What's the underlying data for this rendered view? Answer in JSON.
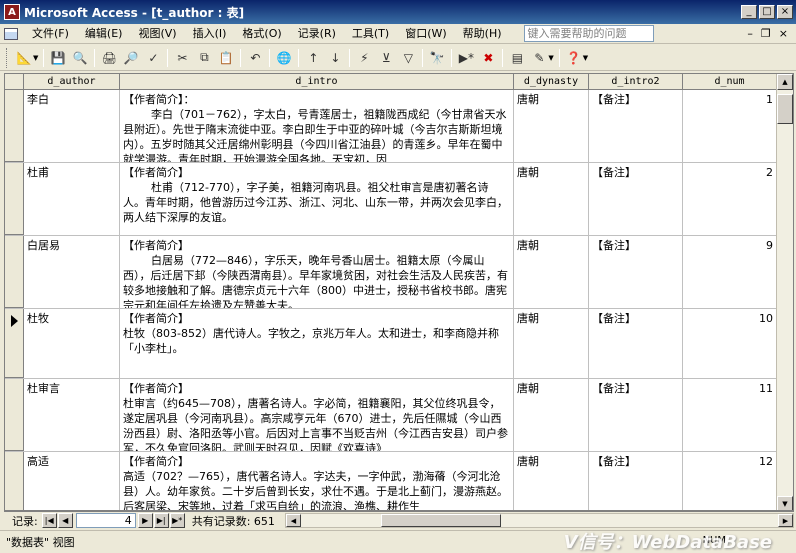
{
  "window": {
    "title": "Microsoft Access - [t_author : 表]",
    "app_icon": "access-icon",
    "controls": [
      "_",
      "□",
      "×"
    ]
  },
  "menu": {
    "items": [
      "文件(F)",
      "编辑(E)",
      "视图(V)",
      "插入(I)",
      "格式(O)",
      "记录(R)",
      "工具(T)",
      "窗口(W)",
      "帮助(H)"
    ],
    "help_placeholder": "键入需要帮助的问题",
    "doc_controls": [
      "–",
      "❐",
      "×"
    ]
  },
  "toolbar": {
    "icons": [
      "view-icon",
      "save-icon",
      "print-icon",
      "print-preview-icon",
      "spellcheck-icon",
      "cut-icon",
      "copy-icon",
      "paste-icon",
      "undo-icon",
      "hyperlink-icon",
      "sort-ascending-icon",
      "sort-descending-icon",
      "filter-by-selection-icon",
      "filter-by-form-icon",
      "apply-filter-icon",
      "find-icon",
      "new-record-icon",
      "delete-record-icon",
      "database-window-icon",
      "new-object-icon",
      "help-icon"
    ]
  },
  "datasheet": {
    "columns": [
      "d_author",
      "d_intro",
      "d_dynasty",
      "d_intro2",
      "d_num"
    ],
    "rows": [
      {
        "d_author": "李白",
        "d_intro": "【作者简介】：\n        李白（701－762），字太白，号青莲居士，祖籍陇西成纪（今甘肃省天水县附近）。先世于隋末流徙中亚。李白即生于中亚的碎叶城（今吉尔吉斯斯坦境内）。五岁时随其父迁居绵州彰明县（今四川省江油县）的青莲乡。早年在蜀中就学漫游。青年时期，开始漫游全国各地。天宝初，因",
        "d_dynasty": "唐朝",
        "d_intro2": "【备注】",
        "d_num": "1",
        "current": false
      },
      {
        "d_author": "杜甫",
        "d_intro": "【作者简介】\n        杜甫（712-770），字子美，祖籍河南巩县。祖父杜审言是唐初著名诗人。青年时期，他曾游历过今江苏、浙江、河北、山东一带，并两次会见李白，两人结下深厚的友谊。",
        "d_dynasty": "唐朝",
        "d_intro2": "【备注】",
        "d_num": "2",
        "current": false
      },
      {
        "d_author": "白居易",
        "d_intro": "【作者简介】\n        白居易（772—846），字乐天，晚年号香山居士。祖籍太原（今属山西），后迁居下邽（今陕西渭南县）。早年家境贫困，对社会生活及人民疾苦，有较多地接触和了解。唐德宗贞元十六年（800）中进士，授秘书省校书郎。唐宪宗元和年间任左拾遗及左赞善大夫。",
        "d_dynasty": "唐朝",
        "d_intro2": "【备注】",
        "d_num": "9",
        "current": false
      },
      {
        "d_author": "杜牧",
        "d_intro": "【作者简介】\n杜牧（803-852）唐代诗人。字牧之，京兆万年人。太和进士，和李商隐并称「小李杜」。",
        "d_dynasty": "唐朝",
        "d_intro2": "【备注】",
        "d_num": "10",
        "current": true
      },
      {
        "d_author": "杜审言",
        "d_intro": "【作者简介】\n杜审言（约645—708），唐著名诗人。字必简，祖籍襄阳，其父位终巩县令，遂定居巩县（今河南巩县）。高宗咸亨元年（670）进士，先后任隰城（今山西汾西县）尉、洛阳丞等小官。后因对上言事不当贬吉州（今江西吉安县）司户参军，不久免官回洛阳。武则天时召见，因赋《欢喜诗》",
        "d_dynasty": "唐朝",
        "d_intro2": "【备注】",
        "d_num": "11",
        "current": false
      },
      {
        "d_author": "高适",
        "d_intro": "【作者简介】\n高适（702？—765），唐代著名诗人。字达夫，一字仲武，渤海蓨（今河北沧县）人。幼年家贫。二十岁后曾到长安，求仕不遇。于是北上蓟门，漫游燕赵。后客居梁、宋等地，过着「求丐自给」的流浪、渔樵、耕作生",
        "d_dynasty": "唐朝",
        "d_intro2": "【备注】",
        "d_num": "12",
        "current": false
      }
    ]
  },
  "navigation": {
    "label": "记录:",
    "current_record": "4",
    "total": "共有记录数: 651",
    "buttons": [
      "|◀",
      "◀",
      "▶",
      "▶|",
      "▶*"
    ]
  },
  "status": {
    "view_text": "\"数据表\" 视图",
    "indicator": "NUM",
    "watermark": "V信号：WebDataBase"
  }
}
